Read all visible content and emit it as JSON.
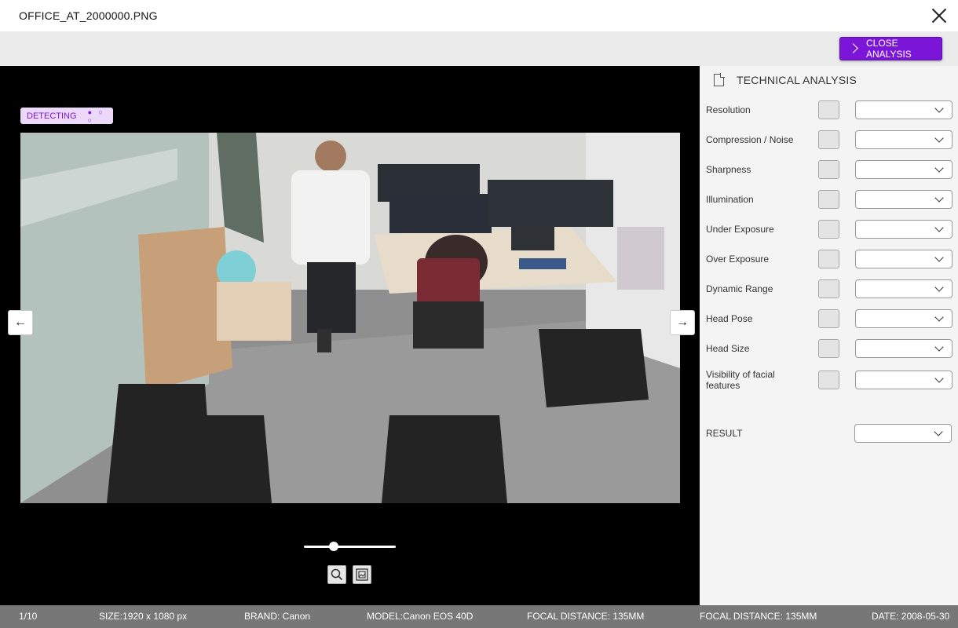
{
  "window": {
    "title": "OFFICE_AT_2000000.PNG"
  },
  "toolbar": {
    "close_analysis_label": "CLOSE ANALYSIS"
  },
  "viewer": {
    "detecting_label": "DETECTING",
    "detecting_dots": "● ○ ○",
    "prev_arrow": "←",
    "next_arrow": "→",
    "zoom_level": 0.3
  },
  "panel": {
    "title": "TECHNICAL ANALYSIS",
    "criteria": [
      {
        "label": "Resolution"
      },
      {
        "label": "Compression / Noise"
      },
      {
        "label": "Sharpness"
      },
      {
        "label": "Illumination"
      },
      {
        "label": "Under Exposure"
      },
      {
        "label": "Over Exposure"
      },
      {
        "label": "Dynamic Range"
      },
      {
        "label": "Head Pose"
      },
      {
        "label": "Head Size"
      },
      {
        "label": "Visibility of facial features"
      }
    ],
    "result_label": "RESULT"
  },
  "status": {
    "page": "1/10",
    "size_key": "SIZE:",
    "size_val": "1920 x 1080 px",
    "brand_key": "BRAND:",
    "brand_val": " Canon",
    "model_key": "MODEL:",
    "model_val": "Canon EOS 40D",
    "focal1_key": "FOCAL DISTANCE:",
    "focal1_val": " 135MM",
    "focal2_key": "FOCAL DISTANCE:",
    "focal2_val": " 135MM",
    "date_key": "DATE:",
    "date_val": " 2008-05-30"
  }
}
